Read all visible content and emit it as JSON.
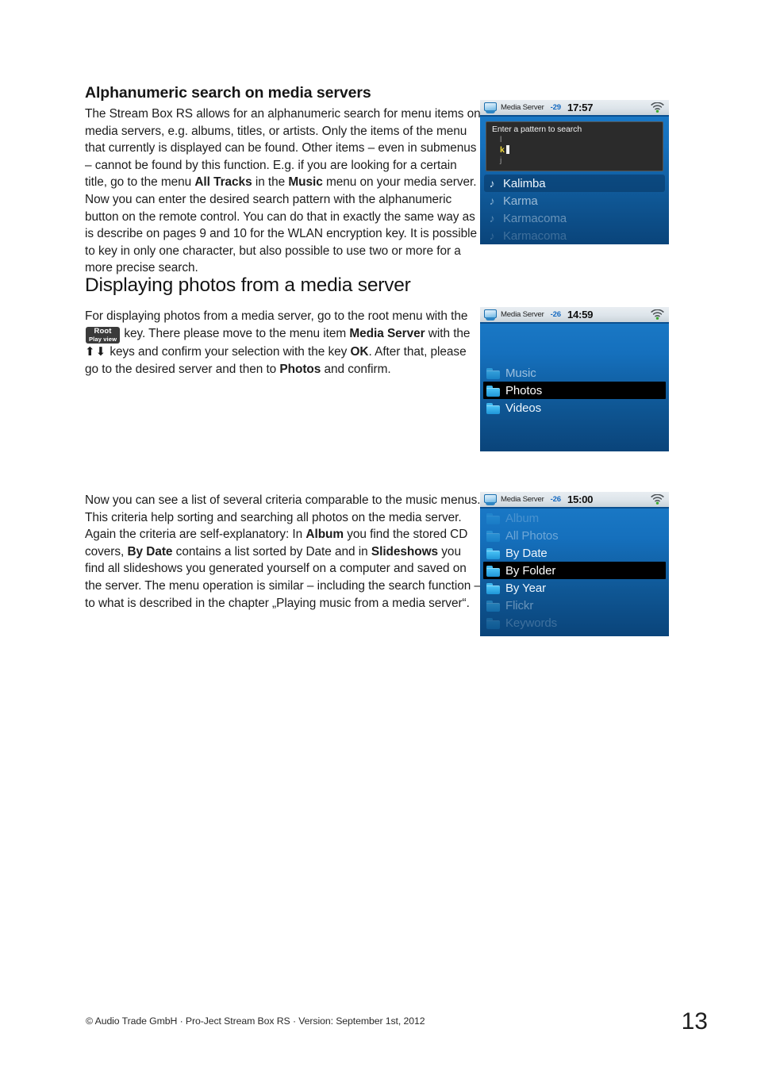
{
  "document": {
    "section1_heading": "Alphanumeric search on media servers",
    "section1_body_1": "The Stream Box RS allows for an alphanumeric search for menu items on media servers, e.g. albums, titles, or artists. Only the items of the menu that currently is displayed can be found. Other items – even in submenus – cannot be found by this function. E.g. if you are looking for a certain title, go to the menu ",
    "section1_bold_1": "All Tracks",
    "section1_body_2": " in the ",
    "section1_bold_2": "Music",
    "section1_body_3": " menu on your media server. Now you can enter the desired search pattern with the alphanumeric button on the remote control. You can do that in exactly the same way as is describe on pages 9 and 10 for the WLAN encryption key. It is possible to key in only one character, but also possible to use two or more for a more precise search.",
    "section2_heading": "Displaying photos from a media server",
    "section2_body_1": "For displaying photos from a media server, go to the root menu with the ",
    "section2_keycap_line1": "Root",
    "section2_keycap_line2": "Play view",
    "section2_body_2": " key. There please move to the menu item ",
    "section2_bold_1": "Media Server",
    "section2_body_3": " with the ",
    "section2_arrows": "⬆⬇",
    "section2_body_4": " keys and confirm your selection with the key ",
    "section2_bold_2": "OK",
    "section2_body_5": ". After that, please go to the desired server and then to ",
    "section2_bold_3": "Photos",
    "section2_body_6": " and confirm.",
    "section3_body_1": "Now you can see a list of several criteria comparable to the music menus. This criteria help sorting and searching all photos on the media server. Again the criteria are self-explanatory: In ",
    "section3_bold_1": "Album",
    "section3_body_2": " you find the stored CD covers, ",
    "section3_bold_2": "By Date",
    "section3_body_3": " contains a list sorted by Date and in ",
    "section3_bold_3": "Slideshows",
    "section3_body_4": " you find all slideshows you generated yourself on a computer and saved on the server. The menu operation is similar – including the search function – to what is described in the chapter „Playing music from a media server“.",
    "footer_text": "© Audio Trade GmbH · Pro-Ject Stream Box RS · Version: September 1st, 2012",
    "page_number": "13"
  },
  "screens": {
    "search": {
      "status": {
        "source_icon": "monitor-icon",
        "source_label": "Media Server",
        "signal": "-29",
        "time": "17:57",
        "wifi_icon": "wifi-icon"
      },
      "dialog": {
        "title": "Enter a pattern to search",
        "char_above": "l",
        "char_current": "k",
        "char_below": "j"
      },
      "results": [
        {
          "label": "Kalimba",
          "icon": "music-note-icon",
          "state": "highlight"
        },
        {
          "label": "Karma",
          "icon": "music-note-icon",
          "state": "fade1"
        },
        {
          "label": "Karmacoma",
          "icon": "music-note-icon",
          "state": "fade2"
        },
        {
          "label": "Karmacoma",
          "icon": "music-note-icon",
          "state": "fade3"
        }
      ]
    },
    "root": {
      "status": {
        "source_icon": "monitor-icon",
        "source_label": "Media Server",
        "signal": "-26",
        "time": "14:59",
        "wifi_icon": "wifi-icon"
      },
      "items": [
        {
          "label": "Music",
          "icon": "folder-icon",
          "state": "fade1"
        },
        {
          "label": "Photos",
          "icon": "folder-icon",
          "state": "selected"
        },
        {
          "label": "Videos",
          "icon": "folder-icon",
          "state": "normal"
        }
      ]
    },
    "photos": {
      "status": {
        "source_icon": "monitor-icon",
        "source_label": "Media Server",
        "signal": "-26",
        "time": "15:00",
        "wifi_icon": "wifi-icon"
      },
      "items": [
        {
          "label": "Album",
          "icon": "folder-icon",
          "state": "fade3"
        },
        {
          "label": "All Photos",
          "icon": "folder-icon",
          "state": "fade2"
        },
        {
          "label": "By Date",
          "icon": "folder-icon",
          "state": "normal"
        },
        {
          "label": "By Folder",
          "icon": "folder-icon",
          "state": "selected"
        },
        {
          "label": "By Year",
          "icon": "folder-icon",
          "state": "normal"
        },
        {
          "label": "Flickr",
          "icon": "folder-icon",
          "state": "fade2"
        },
        {
          "label": "Keywords",
          "icon": "folder-icon",
          "state": "fade3"
        }
      ]
    }
  },
  "colors": {
    "screen_blue_top": "#1c7cc9",
    "screen_blue_bottom": "#0a447a",
    "statusbar_grey": "#dde4ea",
    "signal_blue": "#1469c0",
    "selected_black": "#000000",
    "folder_cyan": "#3fb8ef",
    "caret_yellow": "#f2dc3a",
    "wifi_green": "#3ba92f"
  }
}
